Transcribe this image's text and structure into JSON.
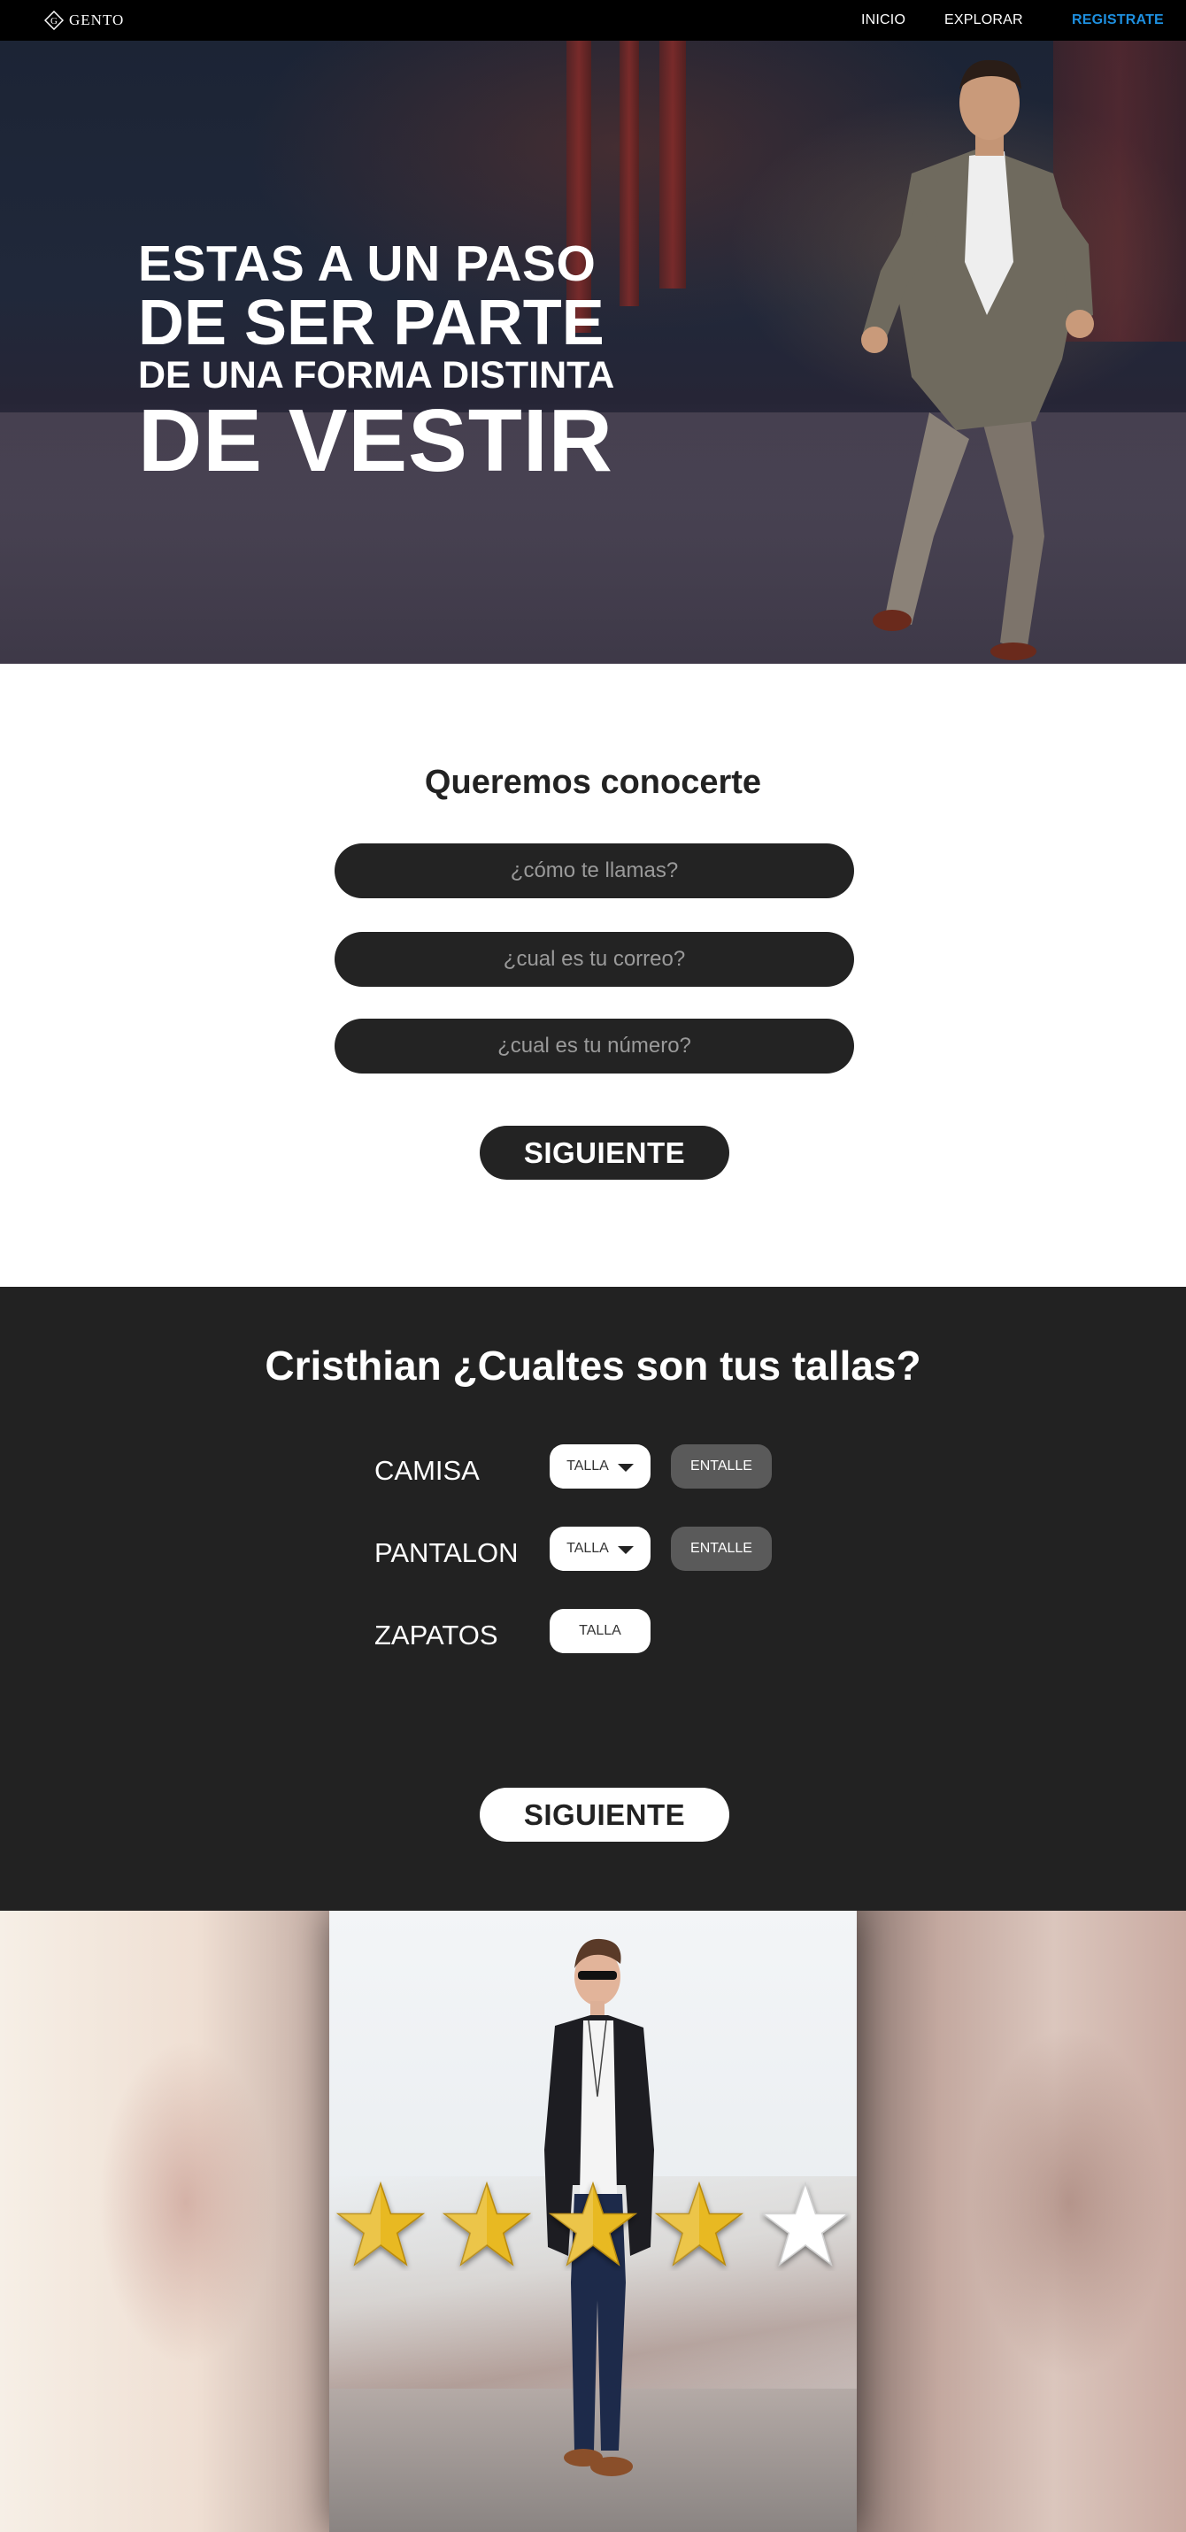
{
  "nav": {
    "logo_text": "GENTO",
    "logo_letter": "G",
    "items": [
      {
        "label": "INICIO"
      },
      {
        "label": "EXPLORAR"
      },
      {
        "label": "REGISTRATE"
      }
    ],
    "accent": "#1e90e0"
  },
  "hero": {
    "line1": "ESTAS A UN PASO",
    "line2": "DE SER PARTE",
    "line3": "DE UNA FORMA DISTINTA",
    "line4": "DE VESTIR"
  },
  "form": {
    "title": "Queremos conocerte",
    "name_placeholder": "¿cómo te llamas?",
    "email_placeholder": "¿cual es tu correo?",
    "phone_placeholder": "¿cual es tu número?",
    "next_label": "SIGUIENTE"
  },
  "sizes": {
    "title": "Cristhian ¿Cualtes son tus tallas?",
    "rows": [
      {
        "label": "CAMISA",
        "talla": "TALLA",
        "entalle": "ENTALLE"
      },
      {
        "label": "PANTALON",
        "talla": "TALLA",
        "entalle": "ENTALLE"
      },
      {
        "label": "ZAPATOS",
        "talla": "TALLA"
      }
    ],
    "next_label": "SIGUIENTE"
  },
  "rating": {
    "stars_total": 5,
    "stars_filled": 4,
    "filled_color": "#e8b923",
    "empty_color": "#ffffff"
  }
}
